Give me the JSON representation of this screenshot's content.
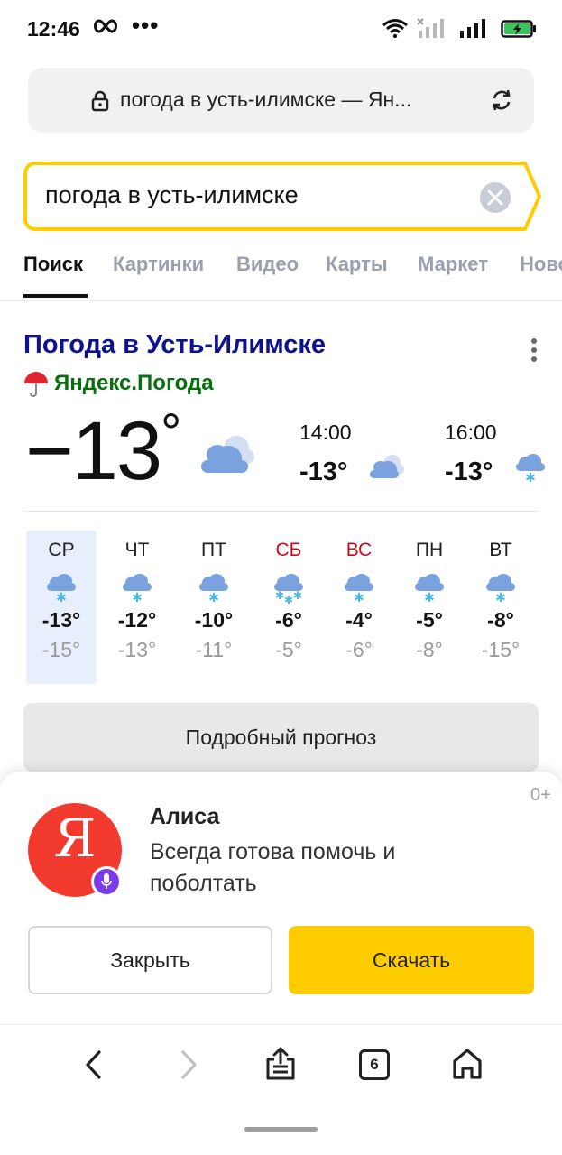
{
  "status_bar": {
    "time": "12:46",
    "dots": "•••",
    "icons": [
      "infinity-icon",
      "wifi-icon",
      "signal-icon-disabled",
      "signal-icon",
      "battery-charging-icon"
    ]
  },
  "url_bar": {
    "text": "погода в усть-илимске — Ян...",
    "icons": [
      "lock-icon",
      "reload-icon"
    ]
  },
  "search": {
    "query": "погода в усть-илимске",
    "accent": "#ffcc00"
  },
  "tabs": [
    {
      "label": "Поиск",
      "active": true
    },
    {
      "label": "Картинки",
      "active": false
    },
    {
      "label": "Видео",
      "active": false
    },
    {
      "label": "Карты",
      "active": false
    },
    {
      "label": "Маркет",
      "active": false
    },
    {
      "label": "Новости",
      "active": false
    }
  ],
  "weather": {
    "title": "Погода в Усть-Илимске",
    "source": "Яндекс.Погода",
    "source_icon": "umbrella-icon",
    "current_temp": "−13",
    "degree": "°",
    "current_icon": "cloudy-icon",
    "hourly": [
      {
        "time": "14:00",
        "temp": "-13°",
        "icon": "cloudy-icon"
      },
      {
        "time": "16:00",
        "temp": "-13°",
        "icon": "snow-icon"
      }
    ],
    "days": [
      {
        "name": "СР",
        "hi": "-13°",
        "lo": "-15°",
        "weekend": false,
        "today": true,
        "icon": "snow-icon"
      },
      {
        "name": "ЧТ",
        "hi": "-12°",
        "lo": "-13°",
        "weekend": false,
        "today": false,
        "icon": "snow-icon"
      },
      {
        "name": "ПТ",
        "hi": "-10°",
        "lo": "-11°",
        "weekend": false,
        "today": false,
        "icon": "snow-icon"
      },
      {
        "name": "СБ",
        "hi": "-6°",
        "lo": "-5°",
        "weekend": true,
        "today": false,
        "icon": "heavy-snow-icon"
      },
      {
        "name": "ВС",
        "hi": "-4°",
        "lo": "-6°",
        "weekend": true,
        "today": false,
        "icon": "snow-icon"
      },
      {
        "name": "ПН",
        "hi": "-5°",
        "lo": "-8°",
        "weekend": false,
        "today": false,
        "icon": "snow-icon"
      },
      {
        "name": "ВТ",
        "hi": "-8°",
        "lo": "-15°",
        "weekend": false,
        "today": false,
        "icon": "snow-icon"
      }
    ],
    "forecast_button": "Подробный прогноз",
    "colors": {
      "title": "#0e128c",
      "source": "#06700d",
      "weekend": "#c40f1f",
      "today_bg": "#e7eefc"
    }
  },
  "alice": {
    "age": "0+",
    "logo_letter": "Я",
    "title": "Алиса",
    "description": "Всегда готова помочь и поболтать",
    "close_label": "Закрыть",
    "download_label": "Скачать",
    "colors": {
      "logo": "#f33a2e",
      "mic": "#7c3aed",
      "download": "#ffcc00"
    }
  },
  "bottom_nav": {
    "tabs_count": "6",
    "icons": [
      "back-icon",
      "forward-icon",
      "share-icon",
      "tabs-icon",
      "home-icon"
    ]
  }
}
